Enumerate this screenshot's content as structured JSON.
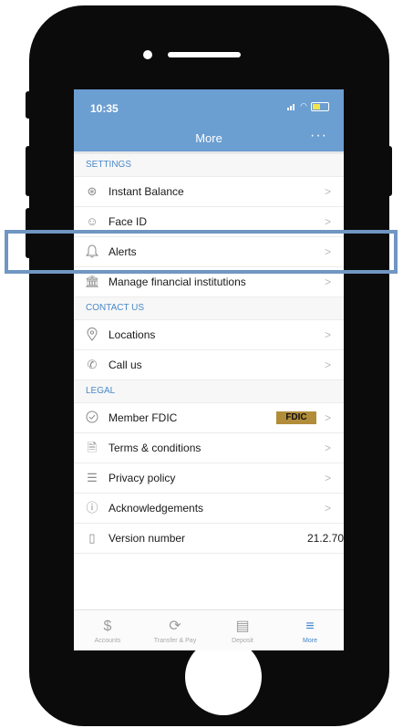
{
  "status_bar": {
    "time": "10:35"
  },
  "nav": {
    "title": "More",
    "menu": "···"
  },
  "sections": [
    {
      "title": "SETTINGS",
      "rows": [
        {
          "label": "Instant Balance",
          "icon": "instant-balance-icon"
        },
        {
          "label": "Face ID",
          "icon": "face-id-icon"
        },
        {
          "label": "Alerts",
          "icon": "bell-icon"
        },
        {
          "label": "Manage financial institutions",
          "icon": "bank-icon"
        }
      ]
    },
    {
      "title": "CONTACT US",
      "rows": [
        {
          "label": "Locations",
          "icon": "map-pin-icon"
        },
        {
          "label": "Call us",
          "icon": "phone-icon"
        }
      ]
    },
    {
      "title": "LEGAL",
      "rows": [
        {
          "label": "Member FDIC",
          "icon": "shield-check-icon",
          "badge": "FDIC"
        },
        {
          "label": "Terms & conditions",
          "icon": "document-icon"
        },
        {
          "label": "Privacy policy",
          "icon": "notes-icon"
        },
        {
          "label": "Acknowledgements",
          "icon": "info-icon"
        },
        {
          "label": "Version number",
          "icon": "device-icon",
          "value": "21.2.70"
        }
      ]
    }
  ],
  "tabs": [
    {
      "label": "Accounts",
      "icon": "dollar-icon"
    },
    {
      "label": "Transfer & Pay",
      "icon": "transfer-icon"
    },
    {
      "label": "Deposit",
      "icon": "check-deposit-icon"
    },
    {
      "label": "More",
      "icon": "hamburger-icon"
    }
  ],
  "colors": {
    "header": "#6b9ed1",
    "accent": "#3f84cb",
    "highlight": "#7096c2",
    "fdic_badge": "#b18d3a"
  }
}
